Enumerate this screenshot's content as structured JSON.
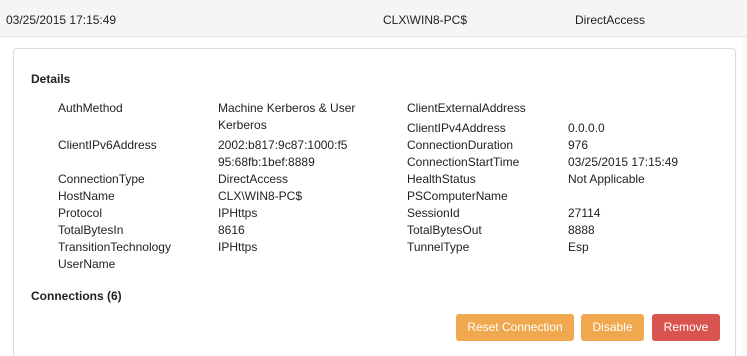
{
  "header": {
    "timestamp": "03/25/2015 17:15:49",
    "username": "CLX\\WIN8-PC$",
    "connection_type": "DirectAccess"
  },
  "details": {
    "title": "Details",
    "left": [
      {
        "key": "AuthMethod",
        "value": [
          "Machine Kerberos & User",
          "Kerberos"
        ]
      },
      {
        "key": "ClientIPv6Address",
        "value": [
          "2002:b817:9c87:1000:f5",
          "95:68fb:1bef:8889"
        ]
      },
      {
        "key": "ConnectionType",
        "value": [
          "DirectAccess"
        ]
      },
      {
        "key": "HostName",
        "value": [
          "CLX\\WIN8-PC$"
        ]
      },
      {
        "key": "Protocol",
        "value": [
          "IPHttps"
        ]
      },
      {
        "key": "TotalBytesIn",
        "value": [
          "8616"
        ]
      },
      {
        "key": "TransitionTechnology",
        "value": [
          "IPHttps"
        ]
      },
      {
        "key": "UserName",
        "value": [
          ""
        ]
      }
    ],
    "right": [
      {
        "key": "ClientExternalAddress",
        "value": ""
      },
      {
        "key": "ClientIPv4Address",
        "value": "0.0.0.0"
      },
      {
        "key": "ConnectionDuration",
        "value": "976"
      },
      {
        "key": "ConnectionStartTime",
        "value": "03/25/2015 17:15:49"
      },
      {
        "key": "HealthStatus",
        "value": "Not Applicable"
      },
      {
        "key": "PSComputerName",
        "value": ""
      },
      {
        "key": "SessionId",
        "value": "27114"
      },
      {
        "key": "TotalBytesOut",
        "value": "8888"
      },
      {
        "key": "TunnelType",
        "value": "Esp"
      }
    ]
  },
  "connections": {
    "title": "Connections (6)"
  },
  "buttons": {
    "reset": "Reset Connection",
    "disable": "Disable",
    "remove": "Remove"
  }
}
